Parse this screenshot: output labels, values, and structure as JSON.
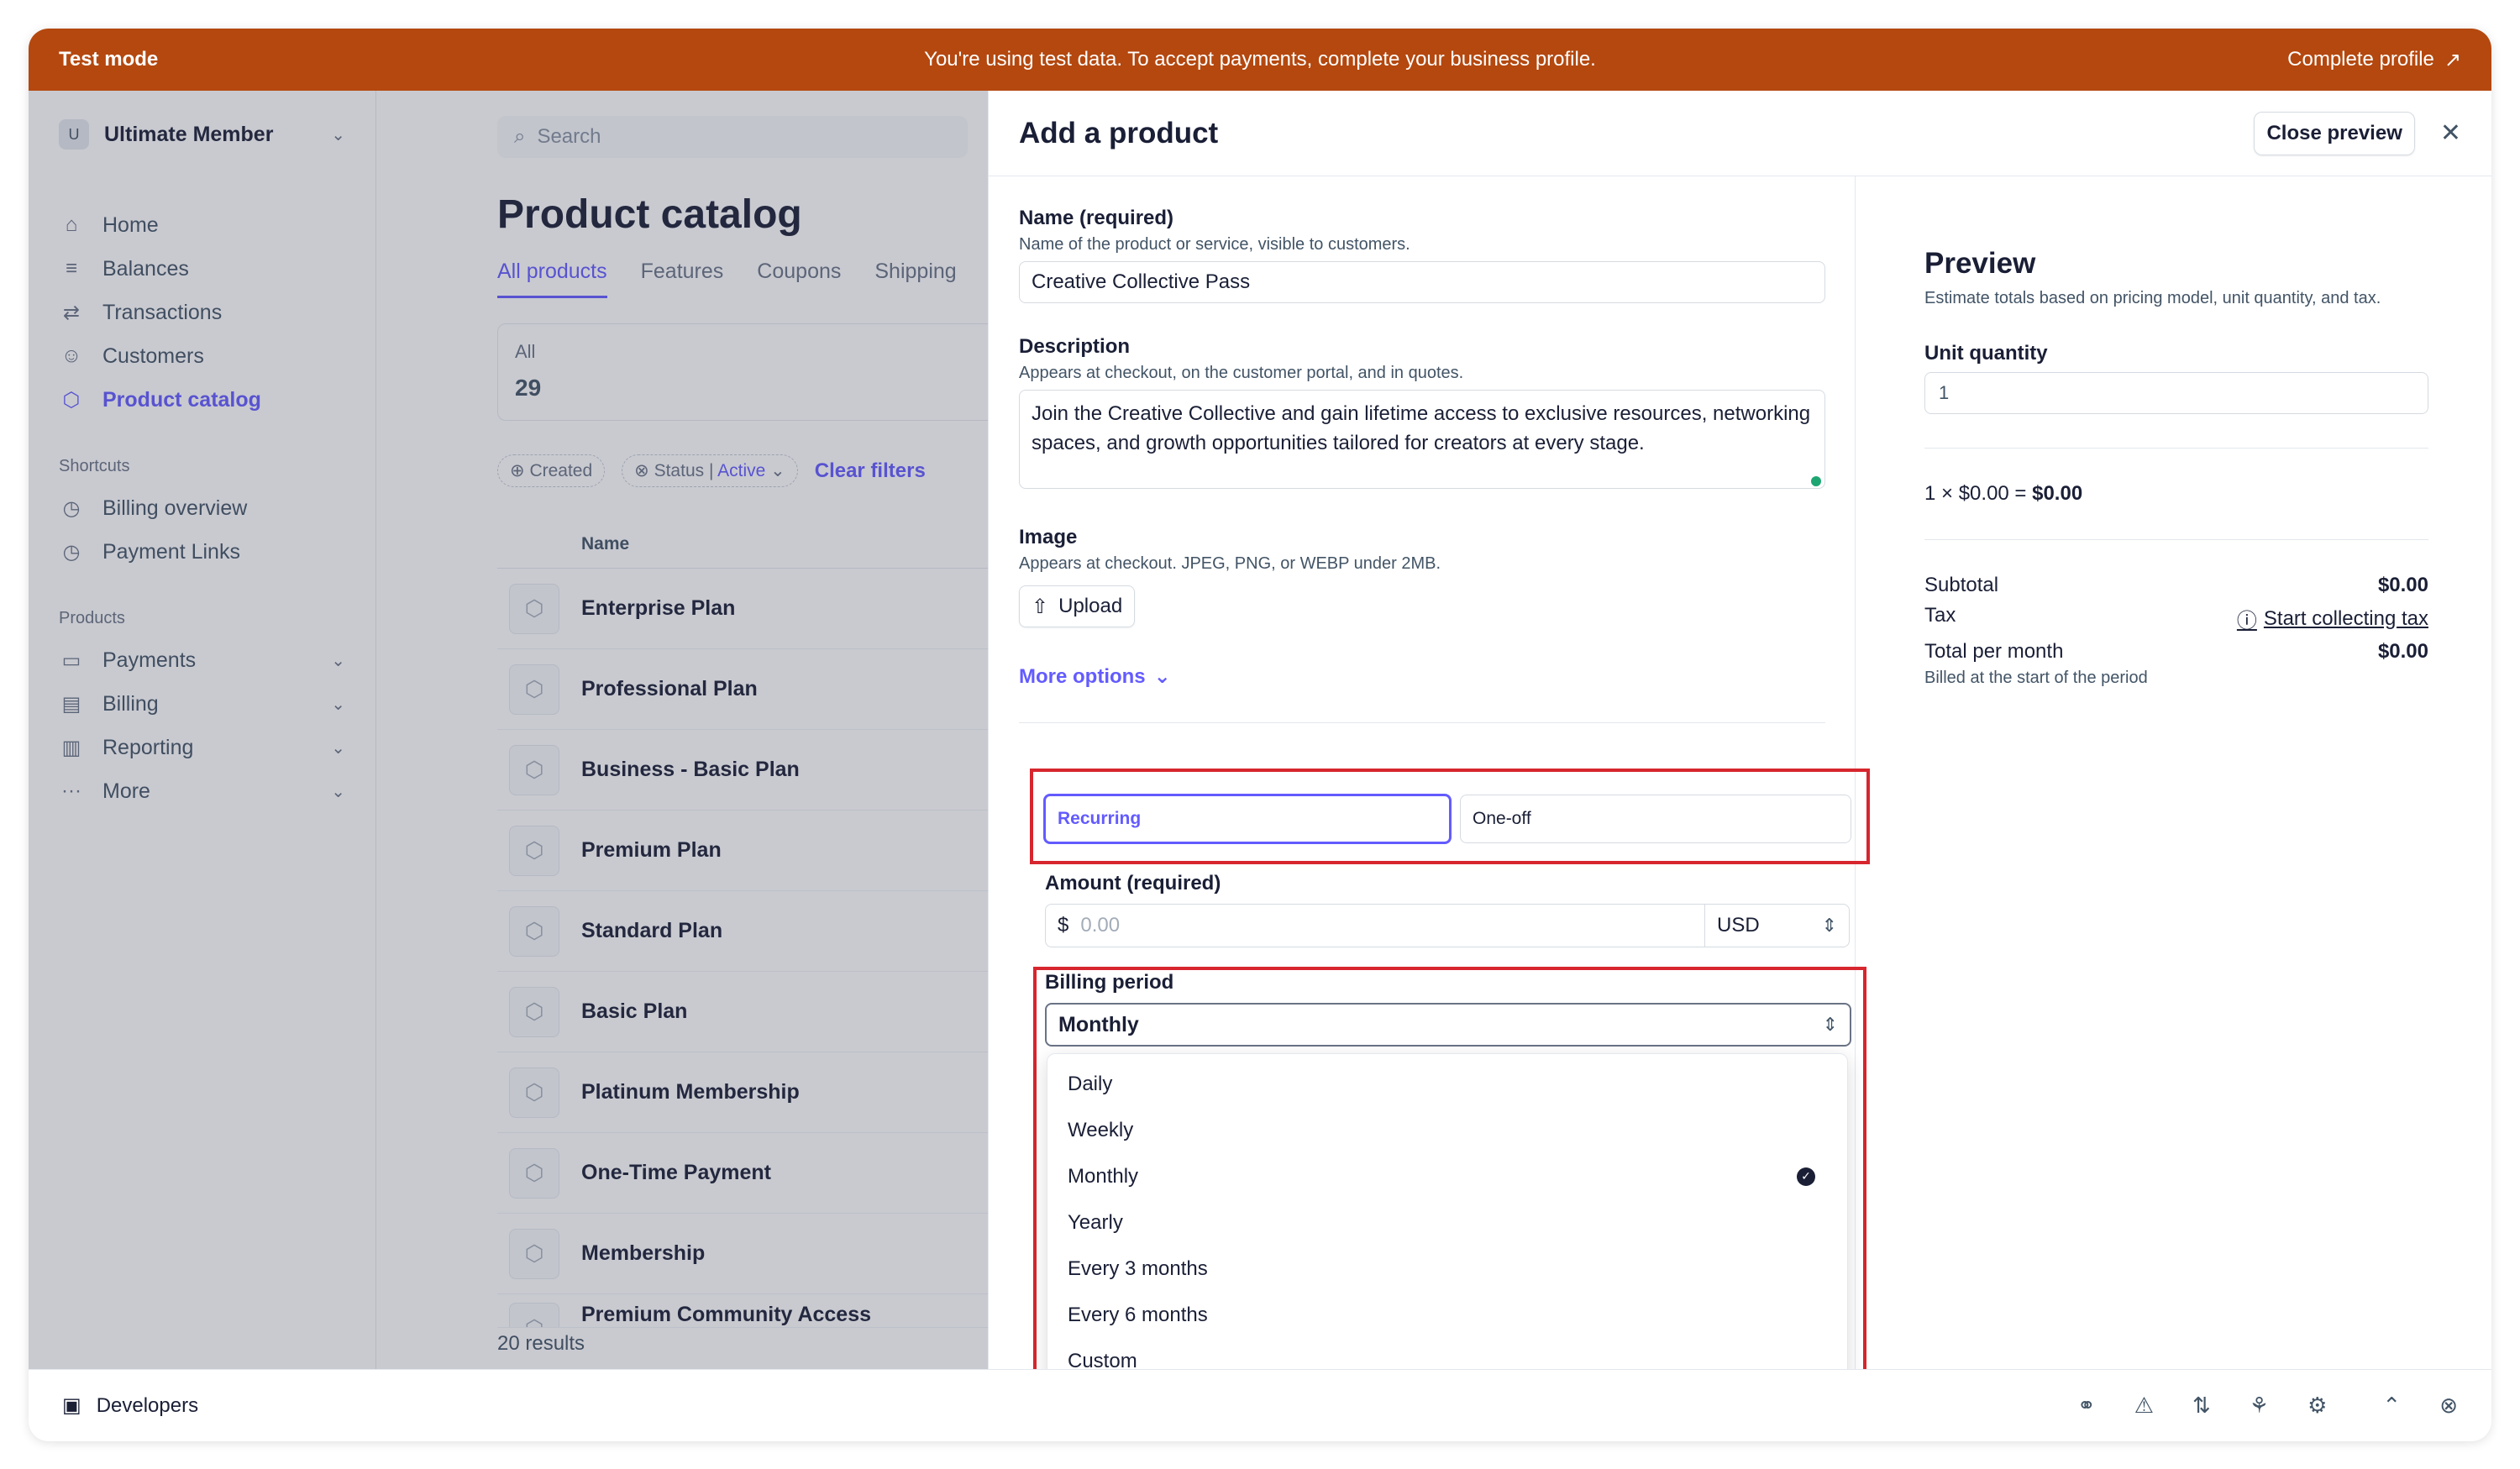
{
  "banner": {
    "mode_label": "Test mode",
    "message": "You're using test data. To accept payments, complete your business profile.",
    "cta_label": "Complete profile"
  },
  "sidebar": {
    "account_initial": "U",
    "account_name": "Ultimate Member",
    "items": [
      {
        "label": "Home",
        "icon": "home-icon"
      },
      {
        "label": "Balances",
        "icon": "balances-icon"
      },
      {
        "label": "Transactions",
        "icon": "transactions-icon"
      },
      {
        "label": "Customers",
        "icon": "customers-icon"
      },
      {
        "label": "Product catalog",
        "icon": "catalog-icon",
        "active": true
      }
    ],
    "shortcuts_title": "Shortcuts",
    "shortcuts": [
      {
        "label": "Billing overview"
      },
      {
        "label": "Payment Links"
      }
    ],
    "products_title": "Products",
    "products": [
      {
        "label": "Payments"
      },
      {
        "label": "Billing"
      },
      {
        "label": "Reporting"
      },
      {
        "label": "More"
      }
    ]
  },
  "main": {
    "search_placeholder": "Search",
    "title": "Product catalog",
    "tabs": [
      "All products",
      "Features",
      "Coupons",
      "Shipping"
    ],
    "count_label": "All",
    "count_value": "29",
    "filter_created": "Created",
    "filter_status": "Status",
    "filter_status_value": "Active",
    "clear_filters": "Clear filters",
    "column_name": "Name",
    "products": [
      "Enterprise Plan",
      "Professional Plan",
      "Business - Basic Plan",
      "Premium Plan",
      "Standard Plan",
      "Basic Plan",
      "Platinum Membership",
      "One-Time Payment",
      "Membership",
      "Premium Community Access"
    ],
    "results": "20 results"
  },
  "drawer": {
    "title": "Add a product",
    "close_preview": "Close preview",
    "name_label": "Name (required)",
    "name_hint": "Name of the product or service, visible to customers.",
    "name_value": "Creative Collective Pass",
    "desc_label": "Description",
    "desc_hint": "Appears at checkout, on the customer portal, and in quotes.",
    "desc_value": "Join the Creative Collective and gain lifetime access to exclusive resources, networking spaces, and growth opportunities tailored for creators at every stage.",
    "image_label": "Image",
    "image_hint": "Appears at checkout. JPEG, PNG, or WEBP under 2MB.",
    "upload_label": "Upload",
    "more_options": "More options",
    "pricing_recurring": "Recurring",
    "pricing_oneoff": "One-off",
    "amount_label": "Amount (required)",
    "amount_currency_symbol": "$",
    "amount_placeholder": "0.00",
    "currency": "USD",
    "billing_label": "Billing period",
    "billing_value": "Monthly",
    "billing_options": [
      "Daily",
      "Weekly",
      "Monthly",
      "Yearly",
      "Every 3 months",
      "Every 6 months",
      "Custom"
    ]
  },
  "preview": {
    "title": "Preview",
    "hint": "Estimate totals based on pricing model, unit quantity, and tax.",
    "unit_label": "Unit quantity",
    "unit_value": "1",
    "calc_prefix": "1 × $0.00 = ",
    "calc_total": "$0.00",
    "subtotal_label": "Subtotal",
    "subtotal_value": "$0.00",
    "tax_label": "Tax",
    "tax_link": "Start collecting tax",
    "total_label": "Total per month",
    "total_value": "$0.00",
    "billed_note": "Billed at the start of the period"
  },
  "bottom": {
    "developers": "Developers"
  },
  "colors": {
    "banner": "#b4480f",
    "accent": "#635bff",
    "highlight": "#d7262e"
  }
}
